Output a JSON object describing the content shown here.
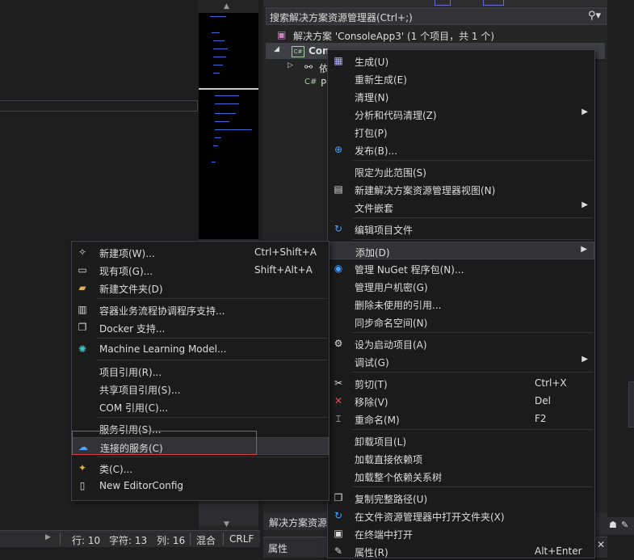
{
  "status": {
    "line": "行: 10",
    "char": "字符: 13",
    "col": "列: 16",
    "mixed": "混合",
    "eol": "CRLF"
  },
  "solution_explorer": {
    "search_placeholder": "搜索解决方案资源管理器(Ctrl+;)",
    "solution_row": "解决方案 'ConsoleApp3' (1 个项目，共 1 个)",
    "project_row": "Con",
    "deps_row": "依",
    "program_row": "P",
    "bottom_tab": "解决方案资源",
    "properties_tab": "属性"
  },
  "context_menu": [
    {
      "icon": "build-icon",
      "label": "生成(U)",
      "shortcut": "",
      "submenu": false
    },
    {
      "icon": "",
      "label": "重新生成(E)",
      "shortcut": "",
      "submenu": false
    },
    {
      "icon": "",
      "label": "清理(N)",
      "shortcut": "",
      "submenu": false
    },
    {
      "icon": "",
      "label": "分析和代码清理(Z)",
      "shortcut": "",
      "submenu": true
    },
    {
      "icon": "",
      "label": "打包(P)",
      "shortcut": "",
      "submenu": false
    },
    {
      "icon": "globe-icon",
      "label": "发布(B)...",
      "shortcut": "",
      "submenu": false
    },
    {
      "icon": "",
      "label": "限定为此范围(S)",
      "shortcut": "",
      "submenu": false
    },
    {
      "icon": "new-view-icon",
      "label": "新建解决方案资源管理器视图(N)",
      "shortcut": "",
      "submenu": false
    },
    {
      "icon": "",
      "label": "文件嵌套",
      "shortcut": "",
      "submenu": true
    },
    {
      "icon": "edit-project-icon",
      "label": "编辑项目文件",
      "shortcut": "",
      "submenu": false
    },
    {
      "icon": "",
      "label": "添加(D)",
      "shortcut": "",
      "submenu": true
    },
    {
      "icon": "nuget-icon",
      "label": "管理 NuGet 程序包(N)...",
      "shortcut": "",
      "submenu": false
    },
    {
      "icon": "",
      "label": "管理用户机密(G)",
      "shortcut": "",
      "submenu": false
    },
    {
      "icon": "",
      "label": "删除未使用的引用...",
      "shortcut": "",
      "submenu": false
    },
    {
      "icon": "",
      "label": "同步命名空间(N)",
      "shortcut": "",
      "submenu": false
    },
    {
      "icon": "gear-icon",
      "label": "设为启动项目(A)",
      "shortcut": "",
      "submenu": false
    },
    {
      "icon": "",
      "label": "调试(G)",
      "shortcut": "",
      "submenu": true
    },
    {
      "icon": "scissors-icon",
      "label": "剪切(T)",
      "shortcut": "Ctrl+X",
      "submenu": false
    },
    {
      "icon": "remove-icon",
      "label": "移除(V)",
      "shortcut": "Del",
      "submenu": false
    },
    {
      "icon": "rename-icon",
      "label": "重命名(M)",
      "shortcut": "F2",
      "submenu": false
    },
    {
      "icon": "",
      "label": "卸载项目(L)",
      "shortcut": "",
      "submenu": false
    },
    {
      "icon": "",
      "label": "加载直接依赖项",
      "shortcut": "",
      "submenu": false
    },
    {
      "icon": "",
      "label": "加载整个依赖关系树",
      "shortcut": "",
      "submenu": false
    },
    {
      "icon": "copy-icon",
      "label": "复制完整路径(U)",
      "shortcut": "",
      "submenu": false
    },
    {
      "icon": "open-folder-icon",
      "label": "在文件资源管理器中打开文件夹(X)",
      "shortcut": "",
      "submenu": false
    },
    {
      "icon": "terminal-icon",
      "label": "在终端中打开",
      "shortcut": "",
      "submenu": false
    },
    {
      "icon": "wrench-icon",
      "label": "属性(R)",
      "shortcut": "Alt+Enter",
      "submenu": false
    }
  ],
  "add_submenu": [
    {
      "icon": "new-item-icon",
      "label": "新建项(W)...",
      "shortcut": "Ctrl+Shift+A"
    },
    {
      "icon": "existing-item-icon",
      "label": "现有项(G)...",
      "shortcut": "Shift+Alt+A"
    },
    {
      "icon": "new-folder-icon",
      "label": "新建文件夹(D)",
      "shortcut": ""
    },
    {
      "icon": "container-icon",
      "label": "容器业务流程协调程序支持...",
      "shortcut": ""
    },
    {
      "icon": "docker-icon",
      "label": "Docker 支持...",
      "shortcut": ""
    },
    {
      "icon": "ml-model-icon",
      "label": "Machine Learning Model...",
      "shortcut": ""
    },
    {
      "icon": "",
      "label": "项目引用(R)...",
      "shortcut": ""
    },
    {
      "icon": "",
      "label": "共享项目引用(S)...",
      "shortcut": ""
    },
    {
      "icon": "",
      "label": "COM 引用(C)...",
      "shortcut": ""
    },
    {
      "icon": "",
      "label": "服务引用(S)...",
      "shortcut": ""
    },
    {
      "icon": "connected-service-icon",
      "label": "连接的服务(C)",
      "shortcut": ""
    },
    {
      "icon": "class-icon",
      "label": "类(C)...",
      "shortcut": ""
    },
    {
      "icon": "editorconfig-icon",
      "label": "New EditorConfig",
      "shortcut": ""
    }
  ]
}
